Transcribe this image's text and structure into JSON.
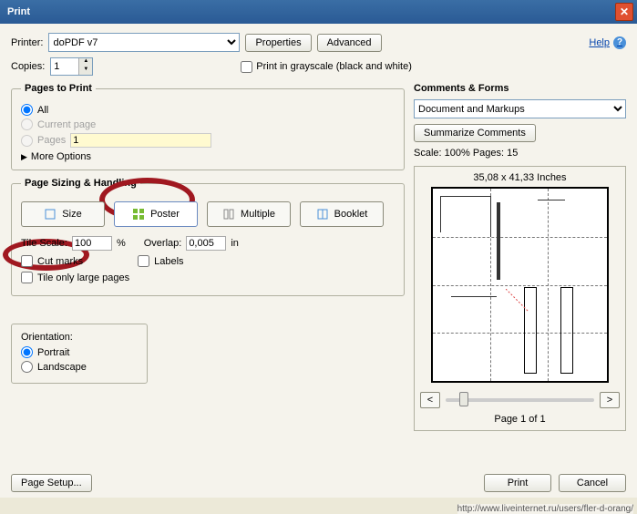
{
  "title": "Print",
  "printer": {
    "label": "Printer:",
    "value": "doPDF v7"
  },
  "buttons": {
    "properties": "Properties",
    "advanced": "Advanced",
    "help": "Help",
    "summarize": "Summarize Comments",
    "page_setup": "Page Setup...",
    "print": "Print",
    "cancel": "Cancel"
  },
  "copies": {
    "label": "Copies:",
    "value": "1"
  },
  "grayscale": {
    "label": "Print in grayscale (black and white)",
    "checked": false
  },
  "pages_to_print": {
    "legend": "Pages to Print",
    "all": "All",
    "current": "Current page",
    "pages": "Pages",
    "pages_value": "1",
    "more": "More Options"
  },
  "sizing": {
    "legend": "Page Sizing & Handling",
    "size": "Size",
    "poster": "Poster",
    "multiple": "Multiple",
    "booklet": "Booklet",
    "tile_scale": "Tile Scale:",
    "tile_scale_val": "100",
    "pct": "%",
    "overlap": "Overlap:",
    "overlap_val": "0,005",
    "unit": "in",
    "cut_marks": "Cut marks",
    "labels": "Labels",
    "tile_only": "Tile only large pages"
  },
  "orientation": {
    "label": "Orientation:",
    "portrait": "Portrait",
    "landscape": "Landscape"
  },
  "comments": {
    "legend": "Comments & Forms",
    "value": "Document and Markups"
  },
  "preview": {
    "scale": "Scale: 100% Pages: 15",
    "dims": "35,08 x 41,33 Inches",
    "page_of": "Page 1 of 1"
  },
  "footer_url": "http://www.liveinternet.ru/users/fler-d-orang/"
}
